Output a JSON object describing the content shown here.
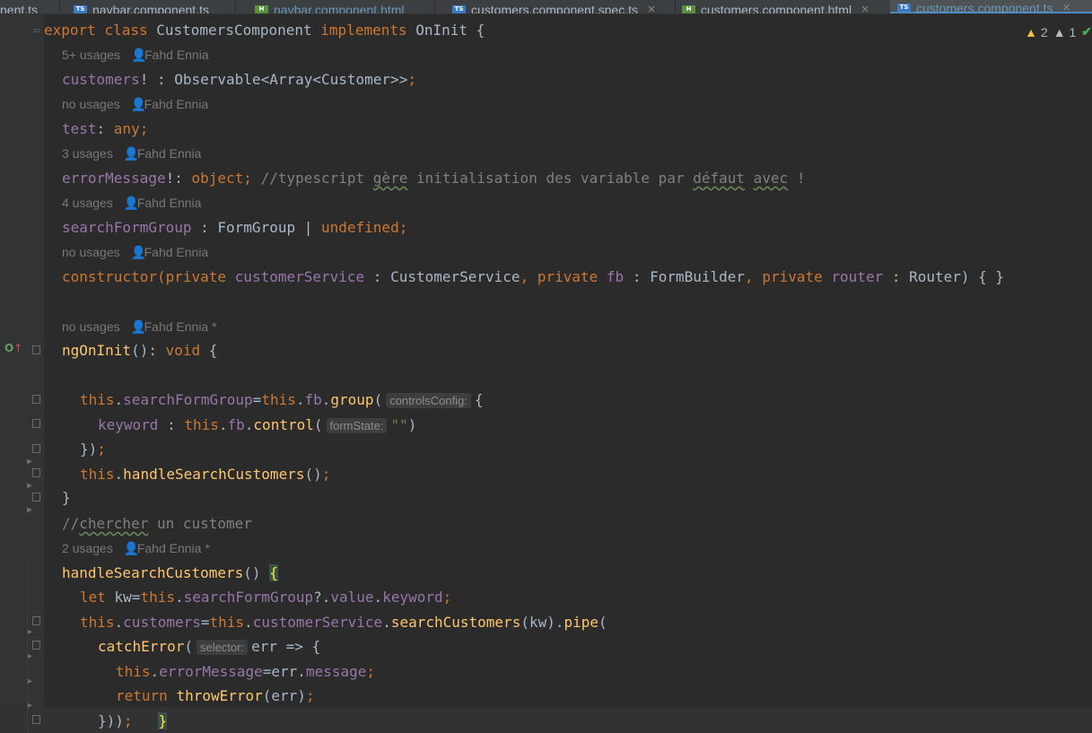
{
  "tabs": [
    {
      "label": "nent.ts",
      "type": "",
      "active": false
    },
    {
      "label": "navbar.component.ts",
      "type": "TS",
      "active": false
    },
    {
      "label": "navbar.component.html",
      "type": "H",
      "active": false
    },
    {
      "label": "customers.component.spec.ts",
      "type": "TS",
      "active": false
    },
    {
      "label": "customers.component.html",
      "type": "H",
      "active": false
    },
    {
      "label": "customers.component.ts",
      "type": "TS",
      "active": true
    }
  ],
  "tab_close_glyph": "×",
  "inspections": {
    "warnings": "2",
    "weak_warnings": "1"
  },
  "hints": {
    "usages_5plus": "5+ usages",
    "no_usages": "no usages",
    "usages_3": "3 usages",
    "usages_4": "4 usages",
    "usages_2": "2 usages",
    "author": "Fahd Ennia",
    "author_modified": "Fahd Ennia *"
  },
  "params": {
    "controls_config": "controlsConfig:",
    "form_state": "formState:",
    "selector": "selector:"
  },
  "code": {
    "l1_export": "export",
    "l1_class": "class",
    "l1_name": "CustomersComponent",
    "l1_implements": "implements",
    "l1_iface": "OnInit {",
    "l2_field": "customers",
    "l2_rest": "! : Observable<Array<Customer>>",
    "semi": ";",
    "l3_field": "test",
    "l3_colon": ": ",
    "l3_type": "any;",
    "l4_field": "errorMessage",
    "l4_punct": "!: ",
    "l4_type": "object;",
    "l4_c1": " //typescript ",
    "l4_c2": "gère",
    "l4_c3": " initialisation des variable par ",
    "l4_c4": "défaut",
    "l4_c5": " ",
    "l4_c6": "avec",
    "l4_c7": " !",
    "l5_field": "searchFormGroup",
    "l5_rest": " : FormGroup | ",
    "l5_undef": "undefined;",
    "l6_ctor": "constructor(",
    "private": "private",
    "l6_p1": "customerService",
    "l6_t1": " : CustomerService",
    "comma": ",",
    "l6_p2": "fb",
    "l6_t2": " : FormBuilder",
    "l6_p3": "router",
    "l6_t3": " : Router) { }",
    "l7_method": "ngOnInit",
    "l7_paren": "(): ",
    "l7_void": "void",
    "l7_brace": " {",
    "this": "this",
    "dot": ".",
    "l8_fg": "searchFormGroup",
    "l8_eq": "=",
    "l8_fb": "fb",
    "l8_group": "group",
    "open_paren": "(",
    "l8_end": "{",
    "l9_key": "keyword",
    "l9_colon": " : ",
    "l9_control": "control",
    "l9_str": "\"\"",
    "l9_close": ")",
    "l10_close": "})",
    "l11_call": "handleSearchCustomers",
    "l11_paren": "()",
    "close_brace": "}",
    "l12_c1": "//",
    "l12_c2": "chercher",
    "l12_c3": " un customer",
    "l13_method": "handleSearchCustomers",
    "l13_paren": "() ",
    "l13_brace": "{",
    "l14_let": "let",
    "l14_kw": " kw=",
    "l14_fg": "searchFormGroup",
    "l14_opt": "?.",
    "l14_value": "value",
    "l14_keyword": "keyword",
    "l15_customers": "customers",
    "l15_service": "customerService",
    "l15_search": "searchCustomers",
    "l15_args": "(kw).",
    "l15_pipe": "pipe",
    "l16_catch": "catchError",
    "l16_arrow": "err => {",
    "l17_msg": "errorMessage",
    "l17_rest": "=err.",
    "l17_message": "message",
    "l18_return": "return",
    "l18_throw": "throwError",
    "l18_args": "(err)",
    "l19_close": "}))",
    "l19_brace": "}"
  },
  "icons": [
    "ts-file-icon",
    "html-file-icon",
    "close-icon",
    "warning-icon",
    "weak-warning-icon",
    "check-icon",
    "person-icon",
    "fold-icon",
    "override-icon"
  ],
  "colors": {
    "keyword": "#cc7832",
    "field": "#9876aa",
    "method": "#ffc66d",
    "string": "#6a8759",
    "comment": "#808080",
    "text": "#a9b7c6",
    "hint": "#787878"
  }
}
